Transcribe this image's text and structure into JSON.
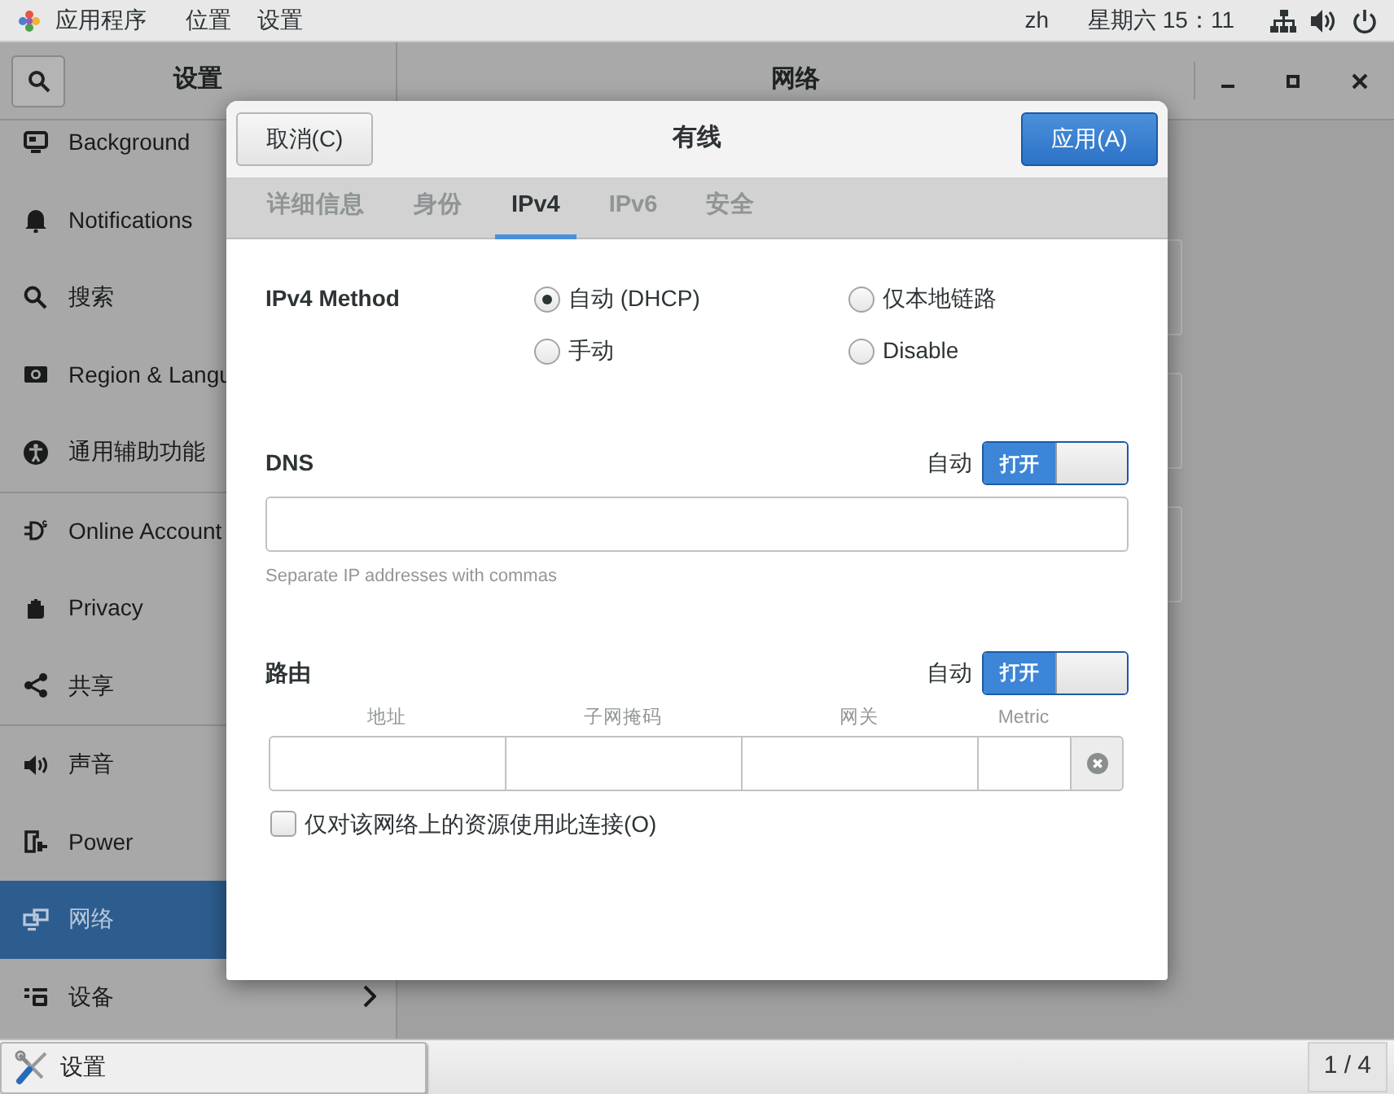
{
  "top_bar": {
    "app_menu": "应用程序",
    "places_menu": "位置",
    "settings_menu": "设置",
    "language": "zh",
    "clock": "星期六 15：11"
  },
  "settings_window": {
    "sidebar_title": "设置",
    "panel_title": "网络",
    "sidebar_groups": [
      [
        {
          "label": "Background",
          "selected": false
        },
        {
          "label": "Notifications",
          "selected": false
        },
        {
          "label": "搜索",
          "selected": false
        },
        {
          "label": "Region & Langu",
          "selected": false
        },
        {
          "label": "通用辅助功能",
          "selected": false
        }
      ],
      [
        {
          "label": "Online Account",
          "selected": false
        },
        {
          "label": "Privacy",
          "selected": false
        },
        {
          "label": "共享",
          "selected": false
        }
      ],
      [
        {
          "label": "声音",
          "selected": false
        },
        {
          "label": "Power",
          "selected": false
        },
        {
          "label": "网络",
          "selected": true
        },
        {
          "label": "设备",
          "selected": false,
          "has_submenu": true
        }
      ]
    ]
  },
  "dialog": {
    "cancel_button": "取消(C)",
    "title": "有线",
    "apply_button": "应用(A)",
    "tabs": [
      {
        "label": "详细信息",
        "selected": false
      },
      {
        "label": "身份",
        "selected": false
      },
      {
        "label": "IPv4",
        "selected": true
      },
      {
        "label": "IPv6",
        "selected": false
      },
      {
        "label": "安全",
        "selected": false
      }
    ],
    "ipv4_method": {
      "label": "IPv4 Method",
      "options": [
        {
          "label": "自动 (DHCP)",
          "selected": true
        },
        {
          "label": "仅本地链路",
          "selected": false
        },
        {
          "label": "手动",
          "selected": false
        },
        {
          "label": "Disable",
          "selected": false
        }
      ]
    },
    "dns": {
      "label": "DNS",
      "auto_label": "自动",
      "switch": {
        "label": "打开",
        "on": true
      },
      "hint": "Separate IP addresses with commas"
    },
    "routes": {
      "label": "路由",
      "auto_label": "自动",
      "switch": {
        "label": "打开",
        "on": true
      },
      "columns": [
        "地址",
        "子网掩码",
        "网关",
        "Metric"
      ]
    },
    "checkbox": {
      "label": "仅对该网络上的资源使用此连接(O)",
      "checked": false
    }
  },
  "taskbar": {
    "window_button": "设置",
    "workspace": "1 / 4"
  }
}
